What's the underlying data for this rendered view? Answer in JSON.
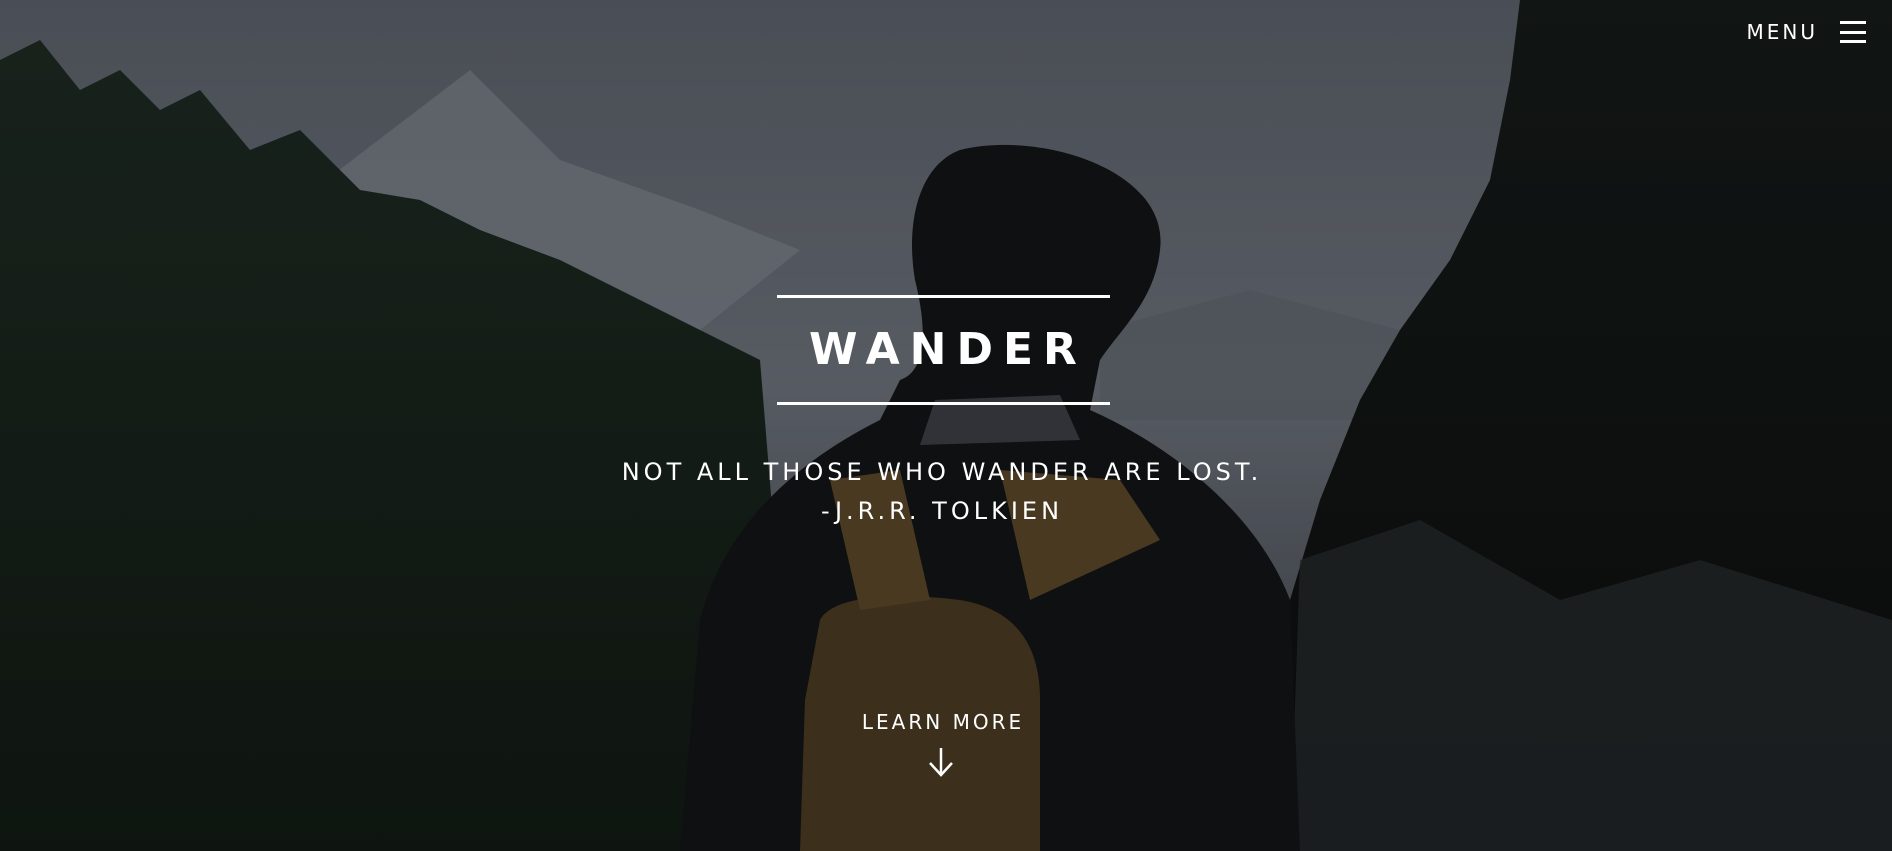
{
  "nav": {
    "menu_label": "MENU",
    "menu_icon": "hamburger-icon"
  },
  "hero": {
    "title": "WANDER",
    "quote_line1": "NOT ALL THOSE WHO WANDER ARE LOST.",
    "quote_line2": "-J.R.R. TOLKIEN",
    "cta_label": "LEARN MORE",
    "cta_icon": "arrow-down-icon"
  },
  "colors": {
    "text": "#ffffff",
    "overlay": "#000000"
  }
}
